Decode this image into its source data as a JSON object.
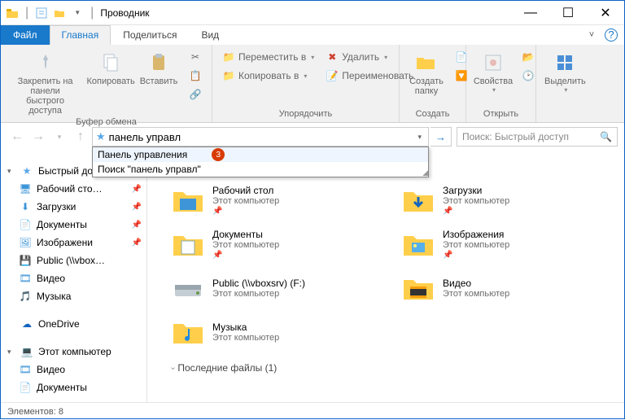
{
  "window": {
    "title": "Проводник"
  },
  "wincontrols": {
    "min": "—",
    "max": "☐",
    "close": "✕"
  },
  "tabs": {
    "file": "Файл",
    "home": "Главная",
    "share": "Поделиться",
    "view": "Вид"
  },
  "ribbon": {
    "clipboard": {
      "pin": "Закрепить на панели\nбыстрого доступа",
      "copy": "Копировать",
      "paste": "Вставить",
      "label": "Буфер обмена"
    },
    "organize": {
      "move": "Переместить в",
      "copyto": "Копировать в",
      "delete": "Удалить",
      "rename": "Переименовать",
      "label": "Упорядочить"
    },
    "new": {
      "folder": "Создать\nпапку",
      "label": "Создать"
    },
    "open": {
      "props": "Свойства",
      "label": "Открыть"
    },
    "select": {
      "select": "Выделить",
      "label": ""
    }
  },
  "address": {
    "value": "панель управл",
    "suggestions": [
      {
        "text": "Панель управления",
        "badge": "3"
      },
      {
        "text": "Поиск \"панель управл\""
      }
    ]
  },
  "search": {
    "placeholder": "Поиск: Быстрый доступ"
  },
  "sidebar": {
    "quick": "Быстрый досту",
    "items": [
      {
        "label": "Рабочий сто…",
        "icon": "desktop"
      },
      {
        "label": "Загрузки",
        "icon": "downloads"
      },
      {
        "label": "Документы",
        "icon": "documents"
      },
      {
        "label": "Изображени",
        "icon": "pictures"
      },
      {
        "label": "Public (\\\\vbox…",
        "icon": "netdrive"
      },
      {
        "label": "Видео",
        "icon": "video"
      },
      {
        "label": "Музыка",
        "icon": "music"
      }
    ],
    "onedrive": "OneDrive",
    "thispc": "Этот компьютер",
    "pcitems": [
      {
        "label": "Видео",
        "icon": "video"
      },
      {
        "label": "Документы",
        "icon": "documents"
      }
    ]
  },
  "folders": [
    {
      "name": "Рабочий стол",
      "sub": "Этот компьютер",
      "icon": "desktop",
      "pinned": true
    },
    {
      "name": "Загрузки",
      "sub": "Этот компьютер",
      "icon": "downloads",
      "pinned": true
    },
    {
      "name": "Документы",
      "sub": "Этот компьютер",
      "icon": "documents",
      "pinned": true
    },
    {
      "name": "Изображения",
      "sub": "Этот компьютер",
      "icon": "pictures",
      "pinned": true
    },
    {
      "name": "Public (\\\\vboxsrv) (F:)",
      "sub": "Этот компьютер",
      "icon": "netdrive",
      "pinned": false
    },
    {
      "name": "Видео",
      "sub": "Этот компьютер",
      "icon": "video",
      "pinned": false
    },
    {
      "name": "Музыка",
      "sub": "Этот компьютер",
      "icon": "music",
      "pinned": false
    }
  ],
  "recent": {
    "label": "Последние файлы (1)"
  },
  "status": {
    "text": "Элементов: 8"
  }
}
